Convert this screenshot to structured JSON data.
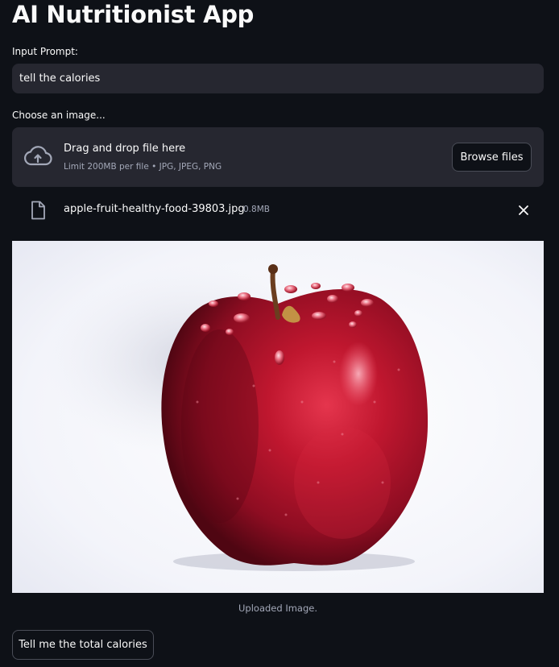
{
  "app": {
    "title": "AI Nutritionist App"
  },
  "prompt": {
    "label": "Input Prompt:",
    "value": "tell the calories"
  },
  "uploader": {
    "label": "Choose an image...",
    "drop_text": "Drag and drop file here",
    "limit_text": "Limit 200MB per file • JPG, JPEG, PNG",
    "browse_label": "Browse files",
    "icon": "cloud-upload-icon"
  },
  "uploaded_file": {
    "name": "apple-fruit-healthy-food-39803.jpg",
    "size": "0.8MB",
    "icon": "file-icon",
    "remove_icon": "close-icon"
  },
  "image": {
    "subject": "red apple",
    "caption": "Uploaded Image."
  },
  "action": {
    "button_label": "Tell me the total calories"
  },
  "colors": {
    "background": "#0e1117",
    "surface": "#262730",
    "text": "#fafafa",
    "muted_text": "#a3a8b8",
    "border": "#4a4d57",
    "apple_red": "#b5102a"
  }
}
